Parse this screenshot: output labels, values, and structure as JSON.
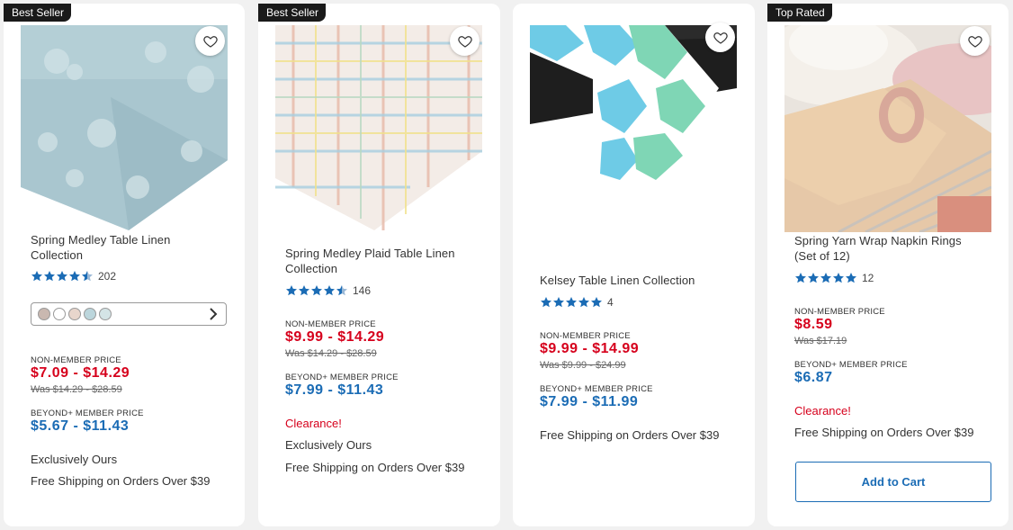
{
  "colors": {
    "price_red": "#d6001c",
    "member_blue": "#1b6cb5",
    "star_blue": "#1b6cb5"
  },
  "products": [
    {
      "badge": "Best Seller",
      "title": "Spring Medley Table Linen Collection",
      "rating": 4.5,
      "review_count": "202",
      "swatch_colors": [
        "#c9b8b0",
        "#ffffff",
        "#e8d6cc",
        "#bcd6dc",
        "#d4e4e6"
      ],
      "non_member_label": "NON-MEMBER PRICE",
      "price": "$7.09 - $14.29",
      "was": "Was $14.29 - $28.59",
      "member_label": "BEYOND+ MEMBER PRICE",
      "member_price": "$5.67 - $11.43",
      "exclusive": "Exclusively Ours",
      "shipping": "Free Shipping on Orders Over $39"
    },
    {
      "badge": "Best Seller",
      "title": "Spring Medley Plaid Table Linen Collection",
      "rating": 4.5,
      "review_count": "146",
      "non_member_label": "NON-MEMBER PRICE",
      "price": "$9.99 - $14.29",
      "was": "Was $14.29 - $28.59",
      "member_label": "BEYOND+ MEMBER PRICE",
      "member_price": "$7.99 - $11.43",
      "clearance": "Clearance!",
      "exclusive": "Exclusively Ours",
      "shipping": "Free Shipping on Orders Over $39"
    },
    {
      "title": "Kelsey Table Linen Collection",
      "rating": 5,
      "review_count": "4",
      "non_member_label": "NON-MEMBER PRICE",
      "price": "$9.99 - $14.99",
      "was": "Was $9.99 - $24.99",
      "member_label": "BEYOND+ MEMBER PRICE",
      "member_price": "$7.99 - $11.99",
      "shipping": "Free Shipping on Orders Over $39"
    },
    {
      "badge": "Top Rated",
      "title": "Spring Yarn Wrap Napkin Rings (Set of 12)",
      "rating": 5,
      "review_count": "12",
      "non_member_label": "NON-MEMBER PRICE",
      "price": "$8.59",
      "was": "Was $17.19",
      "member_label": "BEYOND+ MEMBER PRICE",
      "member_price": "$6.87",
      "clearance": "Clearance!",
      "shipping": "Free Shipping on Orders Over $39",
      "add_to_cart": "Add to Cart"
    }
  ]
}
